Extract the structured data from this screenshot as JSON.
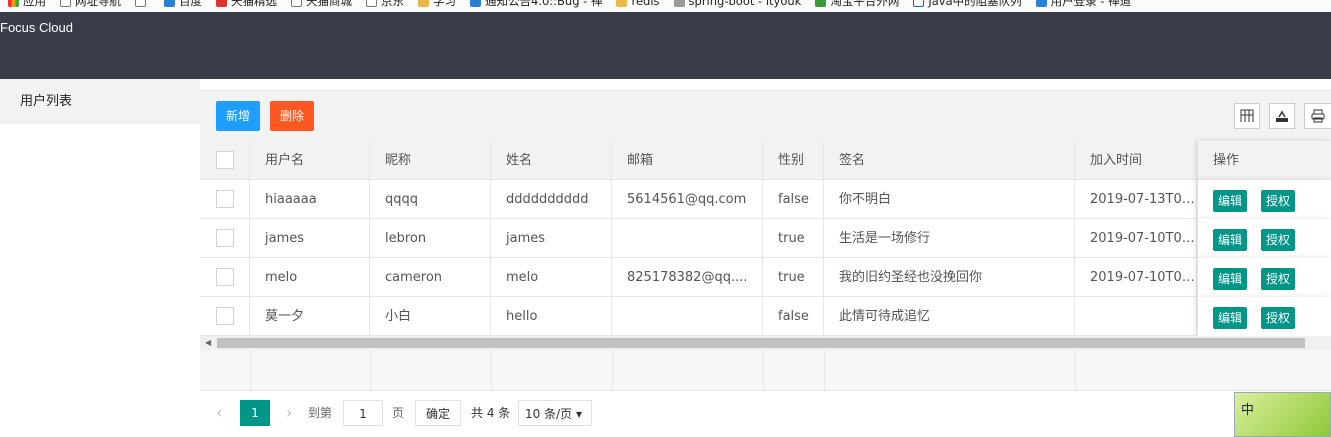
{
  "bookmarks": [
    {
      "label": "应用",
      "icon": "apps-icon"
    },
    {
      "label": "网址导航",
      "icon": "page-icon"
    },
    {
      "label": "",
      "icon": "page-icon"
    },
    {
      "label": "百度",
      "icon": "baidu-icon"
    },
    {
      "label": "天猫精选",
      "icon": "tmall-icon"
    },
    {
      "label": "天猫商城",
      "icon": "page-icon"
    },
    {
      "label": "京东",
      "icon": "page-icon"
    },
    {
      "label": "学习",
      "icon": "folder-icon"
    },
    {
      "label": "通知公告4.0::Bug - 禅",
      "icon": "globe-icon"
    },
    {
      "label": "redis",
      "icon": "folder-icon"
    },
    {
      "label": "spring-boot - ityouk",
      "icon": "gear-icon"
    },
    {
      "label": "淘宝平台外网",
      "icon": "leaf-icon"
    },
    {
      "label": "Java中的阻塞队列",
      "icon": "box-icon"
    },
    {
      "label": "用户登录 - 禅道",
      "icon": "globe-icon"
    }
  ],
  "header": {
    "brand": "Focus Cloud"
  },
  "sidebar": {
    "items": [
      {
        "label": "用户列表"
      }
    ]
  },
  "toolbar": {
    "add_label": "新增",
    "delete_label": "删除"
  },
  "table": {
    "columns": [
      "用户名",
      "昵称",
      "姓名",
      "邮箱",
      "性别",
      "签名",
      "加入时间",
      "操作"
    ],
    "rows": [
      {
        "username": "hiaaaaa",
        "nickname": "qqqq",
        "name": "dddddddddd",
        "email": "5614561@qq.com",
        "gender": "false",
        "signature": "你不明白",
        "joined": "2019-07-13T07:..."
      },
      {
        "username": "james",
        "nickname": "lebron",
        "name": "james",
        "email": "",
        "gender": "true",
        "signature": "生活是一场修行",
        "joined": "2019-07-10T03:..."
      },
      {
        "username": "melo",
        "nickname": "cameron",
        "name": "melo",
        "email": "825178382@qq....",
        "gender": "true",
        "signature": "我的旧约圣经也没挽回你",
        "joined": "2019-07-10T03:..."
      },
      {
        "username": "莫一夕",
        "nickname": "小白",
        "name": "hello",
        "email": "",
        "gender": "false",
        "signature": "此情可待成追忆",
        "joined": ""
      }
    ],
    "row_actions": {
      "edit": "编辑",
      "grant": "授权"
    }
  },
  "pager": {
    "current": "1",
    "goto_prefix": "到第",
    "goto_value": "1",
    "goto_suffix": "页",
    "confirm": "确定",
    "total": "共 4 条",
    "page_size": "10 条/页"
  },
  "ime": {
    "label": "中"
  }
}
